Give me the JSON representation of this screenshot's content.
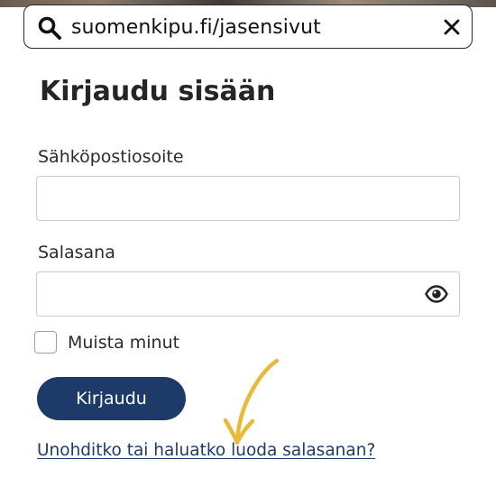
{
  "browser": {
    "url": "suomenkipu.fi/jasensivut",
    "icons": {
      "search": "search-icon",
      "clear": "close-icon"
    }
  },
  "login": {
    "title": "Kirjaudu sisään",
    "email_label": "Sähköpostiosoite",
    "email_value": "",
    "password_label": "Salasana",
    "password_value": "",
    "password_icon": "eye-icon",
    "remember_label": "Muista minut",
    "remember_checked": false,
    "submit_label": "Kirjaudu",
    "forgot_link": "Unohditko tai haluatko luoda salasanan?"
  },
  "colors": {
    "primary": "#1e3a68",
    "annotation_arrow": "#e8b93a",
    "input_border": "#c9c9c9",
    "text": "#2b2b2b"
  },
  "annotation": {
    "icon": "hand-drawn-arrow-icon"
  }
}
